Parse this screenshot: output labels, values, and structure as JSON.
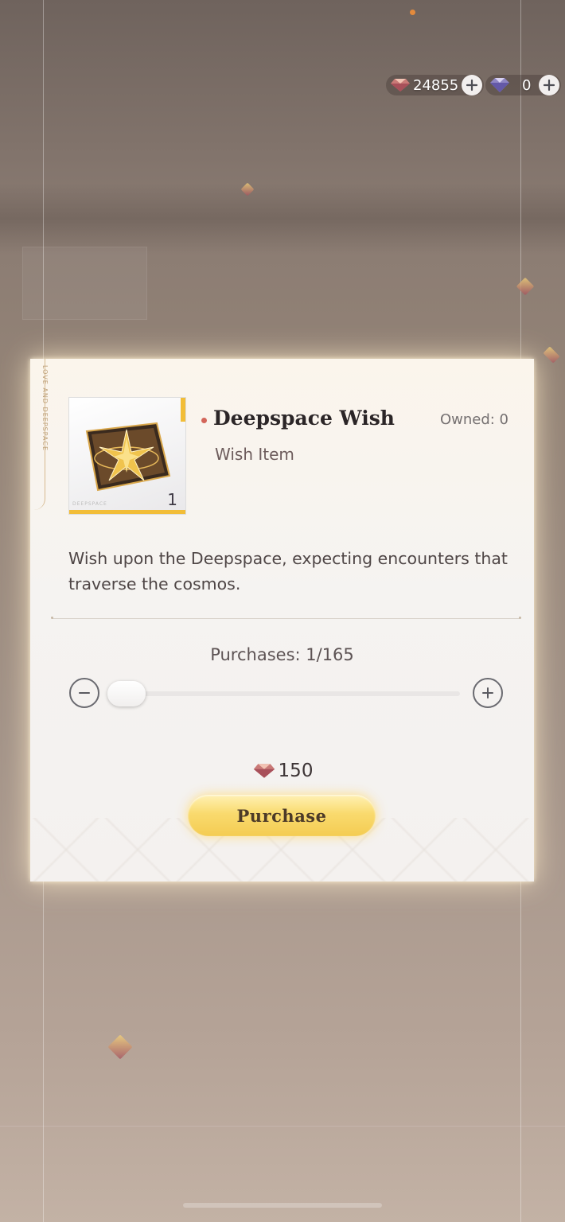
{
  "currency": {
    "primary": {
      "icon": "pink-gem-icon",
      "value": "24855"
    },
    "secondary": {
      "icon": "purple-diamond-icon",
      "value": "0"
    }
  },
  "dialog": {
    "item": {
      "name": "Deepspace Wish",
      "type": "Wish Item",
      "owned": "Owned: 0",
      "count": "1",
      "brand": "DEEPSPACE",
      "description": "Wish upon the Deepspace, expecting encounters that traverse the cosmos."
    },
    "side_label": "LOVE AND DEEPSPACE",
    "quantity": {
      "label": "Purchases: 1/165",
      "current": 1,
      "max": 165
    },
    "price": {
      "icon": "pink-gem-icon",
      "value": "150"
    },
    "purchase_label": "Purchase"
  },
  "colors": {
    "accent_gold": "#f4cc52",
    "card_bar": "#f2bd37",
    "title_dot": "#d3655a"
  }
}
